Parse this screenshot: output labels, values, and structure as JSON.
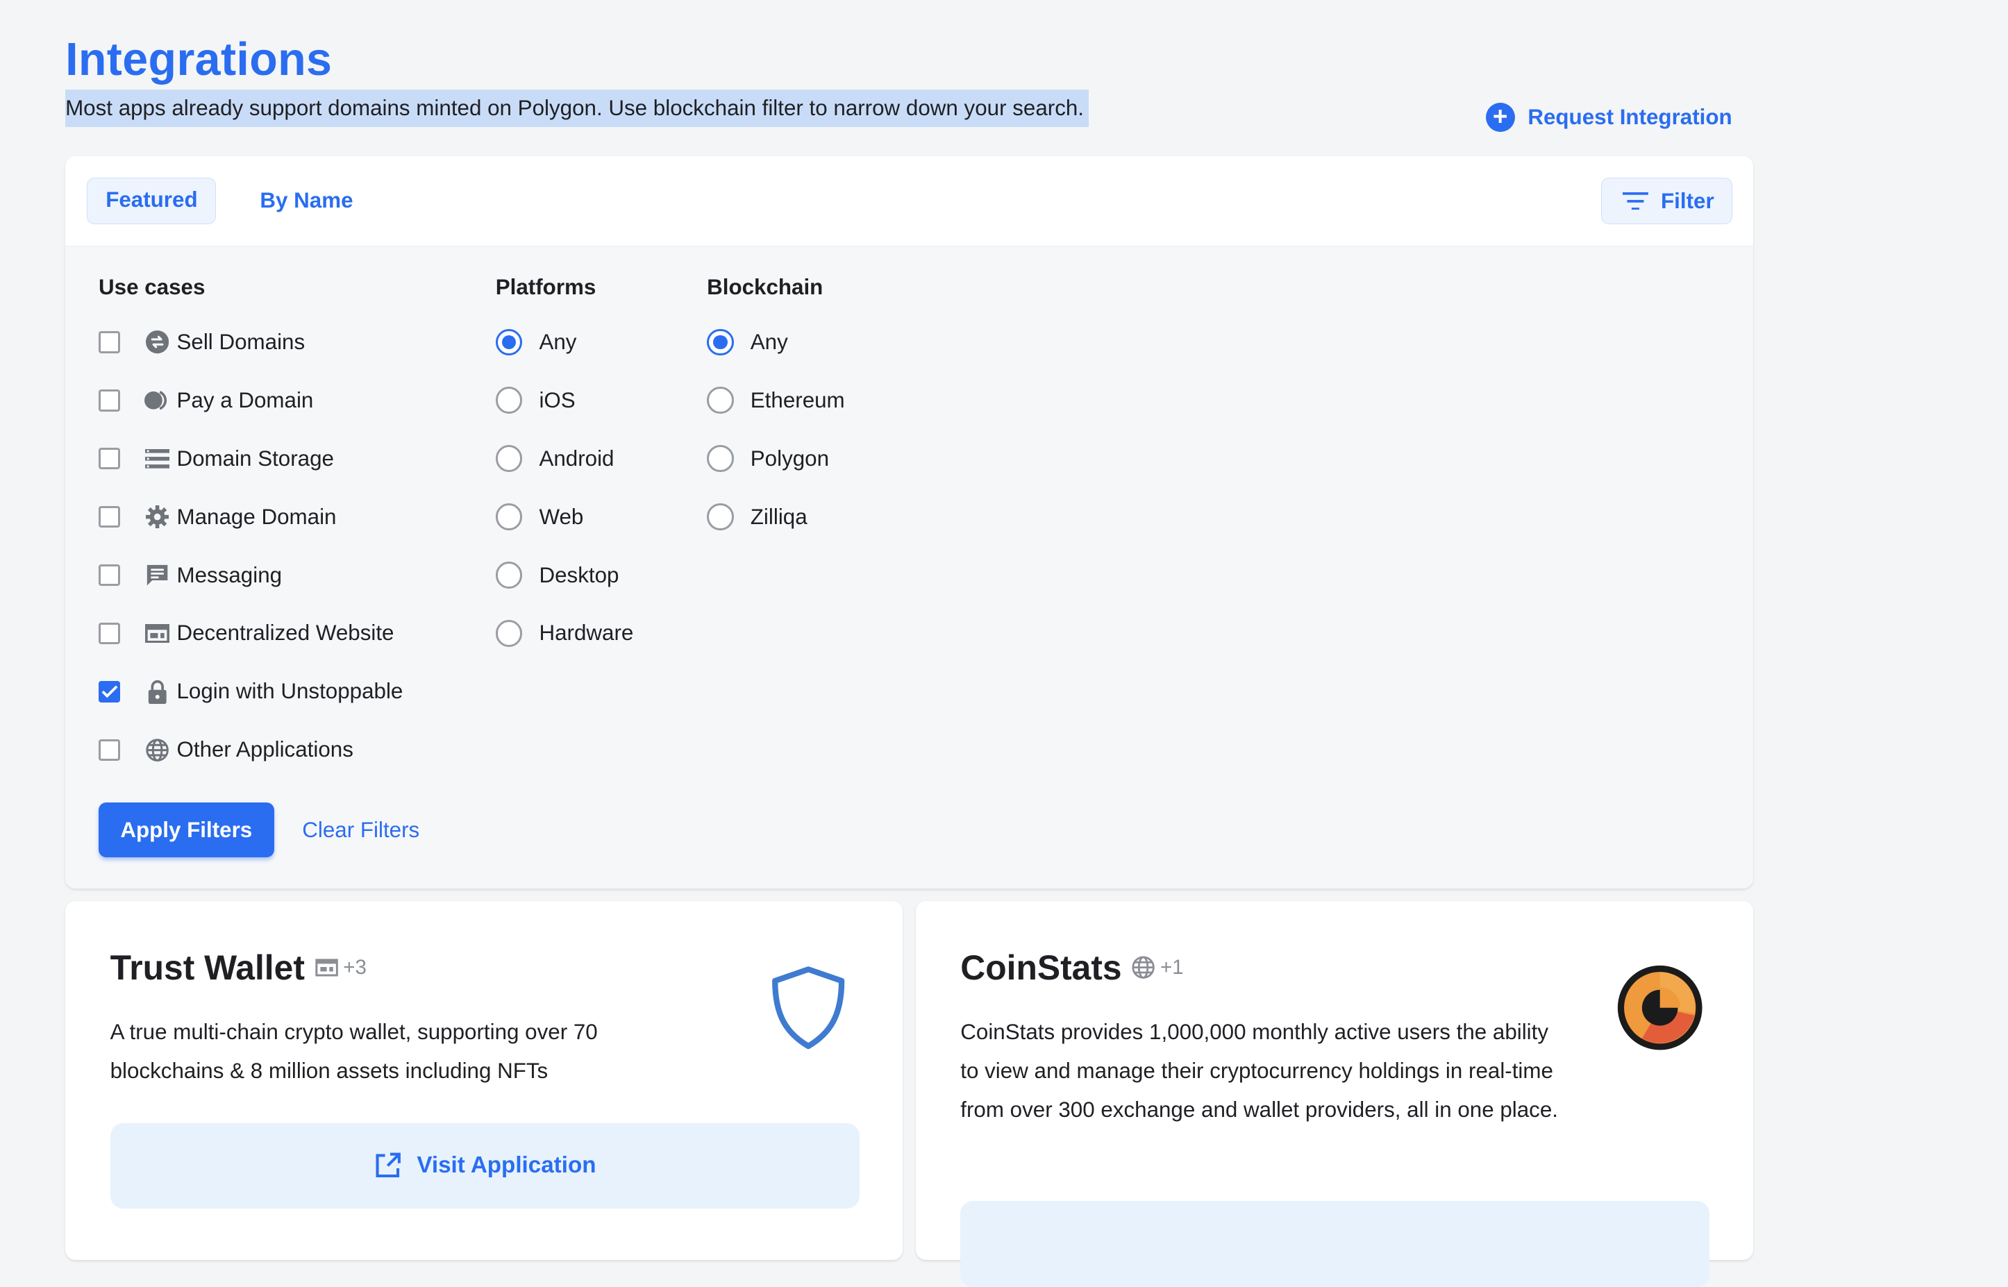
{
  "header": {
    "title": "Integrations",
    "subtitle": "Most apps already support domains minted on Polygon. Use blockchain filter to narrow down your search.",
    "request_integration_label": "Request Integration"
  },
  "tabs": [
    {
      "label": "Featured",
      "active": true
    },
    {
      "label": "By Name",
      "active": false
    }
  ],
  "filter_button_label": "Filter",
  "filters": {
    "use_cases": {
      "heading": "Use cases",
      "options": [
        {
          "label": "Sell Domains",
          "icon": "swap-icon",
          "checked": false
        },
        {
          "label": "Pay a Domain",
          "icon": "coins-icon",
          "checked": false
        },
        {
          "label": "Domain Storage",
          "icon": "storage-icon",
          "checked": false
        },
        {
          "label": "Manage Domain",
          "icon": "gear-icon",
          "checked": false
        },
        {
          "label": "Messaging",
          "icon": "message-icon",
          "checked": false
        },
        {
          "label": "Decentralized Website",
          "icon": "website-icon",
          "checked": false
        },
        {
          "label": "Login with Unstoppable",
          "icon": "lock-icon",
          "checked": true
        },
        {
          "label": "Other Applications",
          "icon": "globe-icon",
          "checked": false
        }
      ]
    },
    "platforms": {
      "heading": "Platforms",
      "options": [
        {
          "label": "Any",
          "checked": true
        },
        {
          "label": "iOS",
          "checked": false
        },
        {
          "label": "Android",
          "checked": false
        },
        {
          "label": "Web",
          "checked": false
        },
        {
          "label": "Desktop",
          "checked": false
        },
        {
          "label": "Hardware",
          "checked": false
        }
      ]
    },
    "blockchain": {
      "heading": "Blockchain",
      "options": [
        {
          "label": "Any",
          "checked": true
        },
        {
          "label": "Ethereum",
          "checked": false
        },
        {
          "label": "Polygon",
          "checked": false
        },
        {
          "label": "Zilliqa",
          "checked": false
        }
      ]
    },
    "apply_label": "Apply Filters",
    "clear_label": "Clear Filters"
  },
  "cards": [
    {
      "title": "Trust Wallet",
      "badge_icon": "website-icon",
      "badge_count": "+3",
      "description": "A true multi-chain crypto wallet, supporting over 70 blockchains & 8 million assets including NFTs",
      "logo": "shield-logo",
      "button_label": "Visit Application"
    },
    {
      "title": "CoinStats",
      "badge_icon": "globe-icon",
      "badge_count": "+1",
      "description": "CoinStats provides 1,000,000 monthly active users the ability to view and manage their cryptocurrency holdings in real-time from over 300 exchange and wallet providers, all in one place.",
      "logo": "coinstats-logo",
      "button_label": ""
    }
  ],
  "colors": {
    "accent": "#2a6df0",
    "page_background": "#f4f5f6",
    "button_soft_background": "#e7f2fd"
  }
}
